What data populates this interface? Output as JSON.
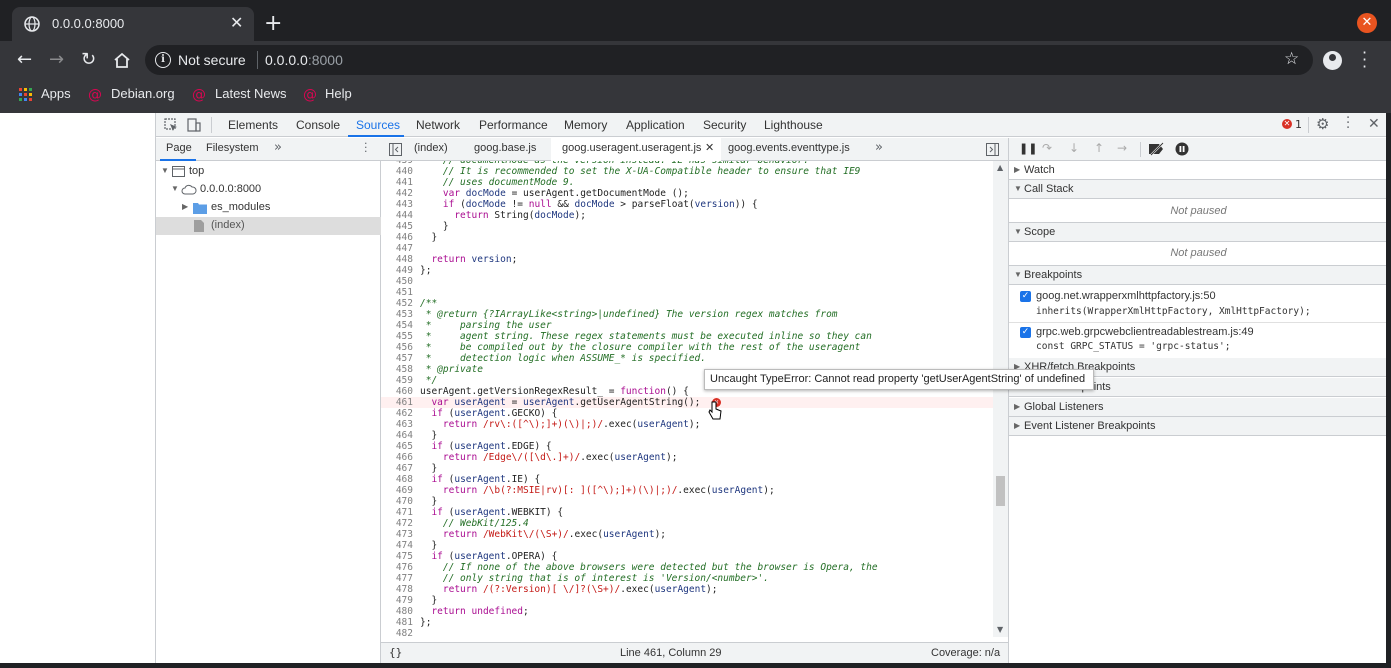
{
  "browser": {
    "tab_title": "0.0.0.0:8000",
    "close_tab": "✕",
    "new_tab": "+",
    "omnibox_security": "Not secure",
    "omnibox_url_host": "0.0.0.0",
    "omnibox_url_port": ":8000",
    "bookmarks": [
      "Apps",
      "Debian.org",
      "Latest News",
      "Help"
    ]
  },
  "devtools": {
    "tabs": [
      "Elements",
      "Console",
      "Sources",
      "Network",
      "Performance",
      "Memory",
      "Application",
      "Security",
      "Lighthouse"
    ],
    "error_count": "1",
    "navigator": {
      "tabs": [
        "Page",
        "Filesystem"
      ],
      "more": "»",
      "tree": [
        {
          "label": "top",
          "indent": 0,
          "arrow": "▼"
        },
        {
          "label": "0.0.0.0:8000",
          "indent": 1,
          "arrow": "▼"
        },
        {
          "label": "es_modules",
          "indent": 2,
          "arrow": "▶"
        },
        {
          "label": "(index)",
          "indent": 2,
          "arrow": ""
        }
      ]
    },
    "editor": {
      "tabs": [
        "(index)",
        "goog.base.js",
        "goog.useragent.useragent.js",
        "goog.events.eventtype.js"
      ],
      "active_close": "✕",
      "more": "»",
      "status_left": "{}",
      "status_pos": "Line 461, Column 29",
      "status_coverage": "Coverage: n/a",
      "tooltip": "Uncaught TypeError: Cannot read property 'getUserAgentString' of undefined"
    },
    "debugger": {
      "sections": {
        "watch": "Watch",
        "call_stack": "Call Stack",
        "scope": "Scope",
        "breakpoints": "Breakpoints",
        "xhr": "XHR/fetch Breakpoints",
        "dom": "DOM Breakpoints",
        "global": "Global Listeners",
        "event": "Event Listener Breakpoints"
      },
      "not_paused": "Not paused",
      "breakpoints": [
        {
          "file": "goog.net.wrapperxmlhttpfactory.js:50",
          "code": "inherits(WrapperXmlHttpFactory, XmlHttpFactory);"
        },
        {
          "file": "grpc.web.grpcwebclientreadablestream.js:49",
          "code": "const GRPC_STATUS = 'grpc-status';"
        }
      ]
    }
  }
}
